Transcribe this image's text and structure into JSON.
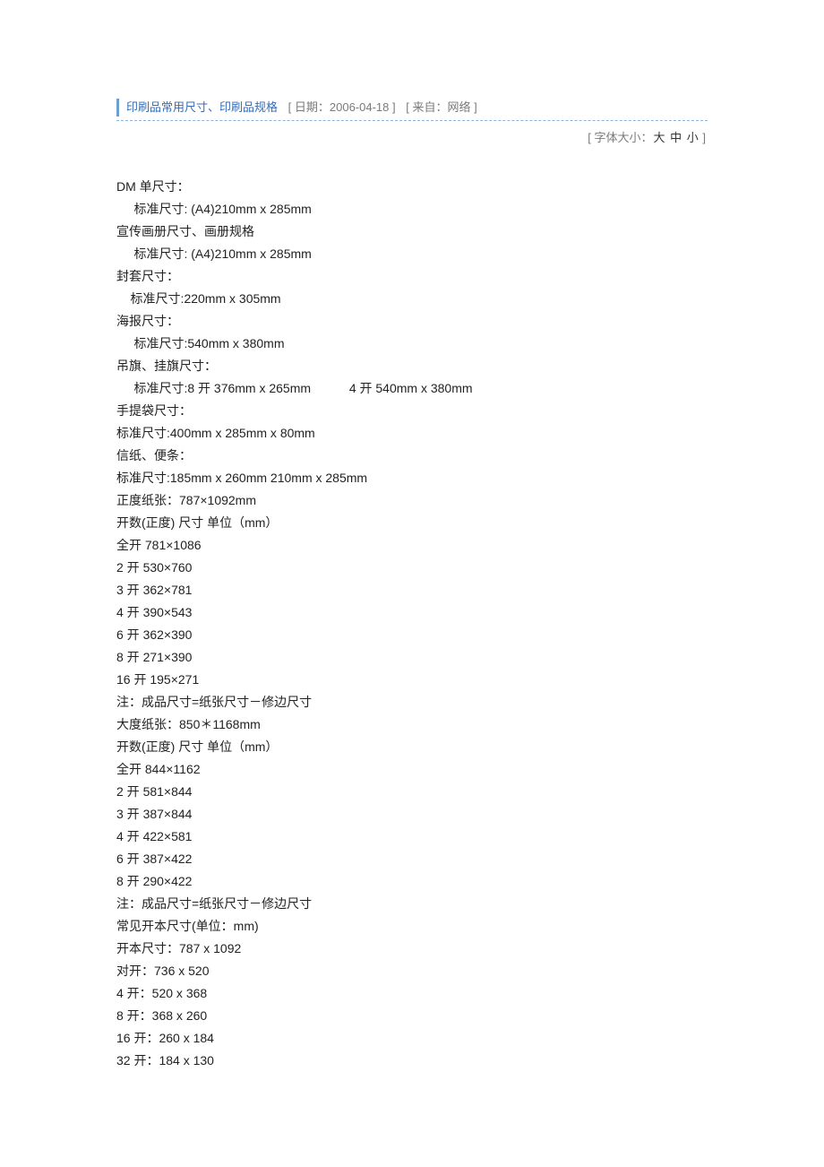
{
  "header": {
    "title": "印刷品常用尺寸、印刷品规格",
    "date_label": "日期：",
    "date_value": "2006-04-18",
    "source_label": "来自：",
    "source_value": "网络"
  },
  "font_row": {
    "label": "字体大小：",
    "large": "大",
    "medium": "中",
    "small": "小"
  },
  "body_lines": [
    "DM 单尺寸：",
    "     标准尺寸: (A4)210mm x 285mm",
    "宣传画册尺寸、画册规格",
    "     标准尺寸: (A4)210mm x 285mm",
    "封套尺寸：",
    "    标准尺寸:220mm x 305mm",
    "海报尺寸：",
    "     标准尺寸:540mm x 380mm",
    "吊旗、挂旗尺寸：",
    "     标准尺寸:8 开 376mm x 265mm           4 开 540mm x 380mm",
    "手提袋尺寸：",
    "标准尺寸:400mm x 285mm x 80mm",
    "信纸、便条：",
    "标准尺寸:185mm x 260mm 210mm x 285mm",
    "正度纸张：787×1092mm",
    "开数(正度) 尺寸 单位（mm）",
    "全开 781×1086",
    "2 开 530×760",
    "3 开 362×781",
    "4 开 390×543",
    "6 开 362×390",
    "8 开 271×390",
    "16 开 195×271",
    "注：成品尺寸=纸张尺寸－修边尺寸",
    "大度纸张：850＊1168mm",
    "开数(正度) 尺寸 单位（mm）",
    "全开 844×1162",
    "2 开 581×844",
    "3 开 387×844",
    "4 开 422×581",
    "6 开 387×422",
    "8 开 290×422",
    "注：成品尺寸=纸张尺寸－修边尺寸",
    "常见开本尺寸(单位：mm)",
    "开本尺寸：787 x 1092",
    "对开：736 x 520",
    "4 开：520 x 368",
    "8 开：368 x 260",
    "16 开：260 x 184",
    "32 开：184 x 130"
  ]
}
